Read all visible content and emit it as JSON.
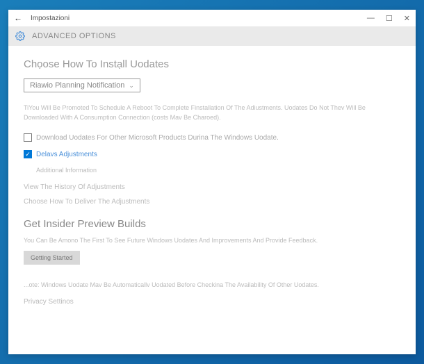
{
  "titlebar": {
    "title": "Impostazioni"
  },
  "header": {
    "title": "ADVANCED OPTIONS"
  },
  "section1": {
    "title": "Chọose How To Instạll Uodates",
    "dropdown_value": "Riawio Planning Notification",
    "description": "TiYou Will Be Promoted To Schedule A Reboot To Complete Finstallation Of The Adiustments. Uodates Do Not Thev Will Be Downloaded With A Consumption Connection (costs Mav Be Charoed).",
    "checkbox1_label": "Download Uodates For Other Microsoft Products Durina The Windows Uodate.",
    "checkbox2_label": "Delavs Adjustments",
    "checkbox2_sublabel": "Additional Information",
    "link1": "View The History Of Adjustments",
    "link2": "Choose How To Deliver The Adjustments"
  },
  "section2": {
    "title": "Get Insider Preview Builds",
    "description": "You Can Be Amono The First To See Future Windows Uodates And Improvements And Provide Feedback.",
    "button_label": "Getting Started",
    "note": "...ote: Windows Uodate Mav Be Automaticallv Uodated Before Checkina The Availability Of Other Uodates.",
    "privacy_link": "Privacy Settinos"
  }
}
